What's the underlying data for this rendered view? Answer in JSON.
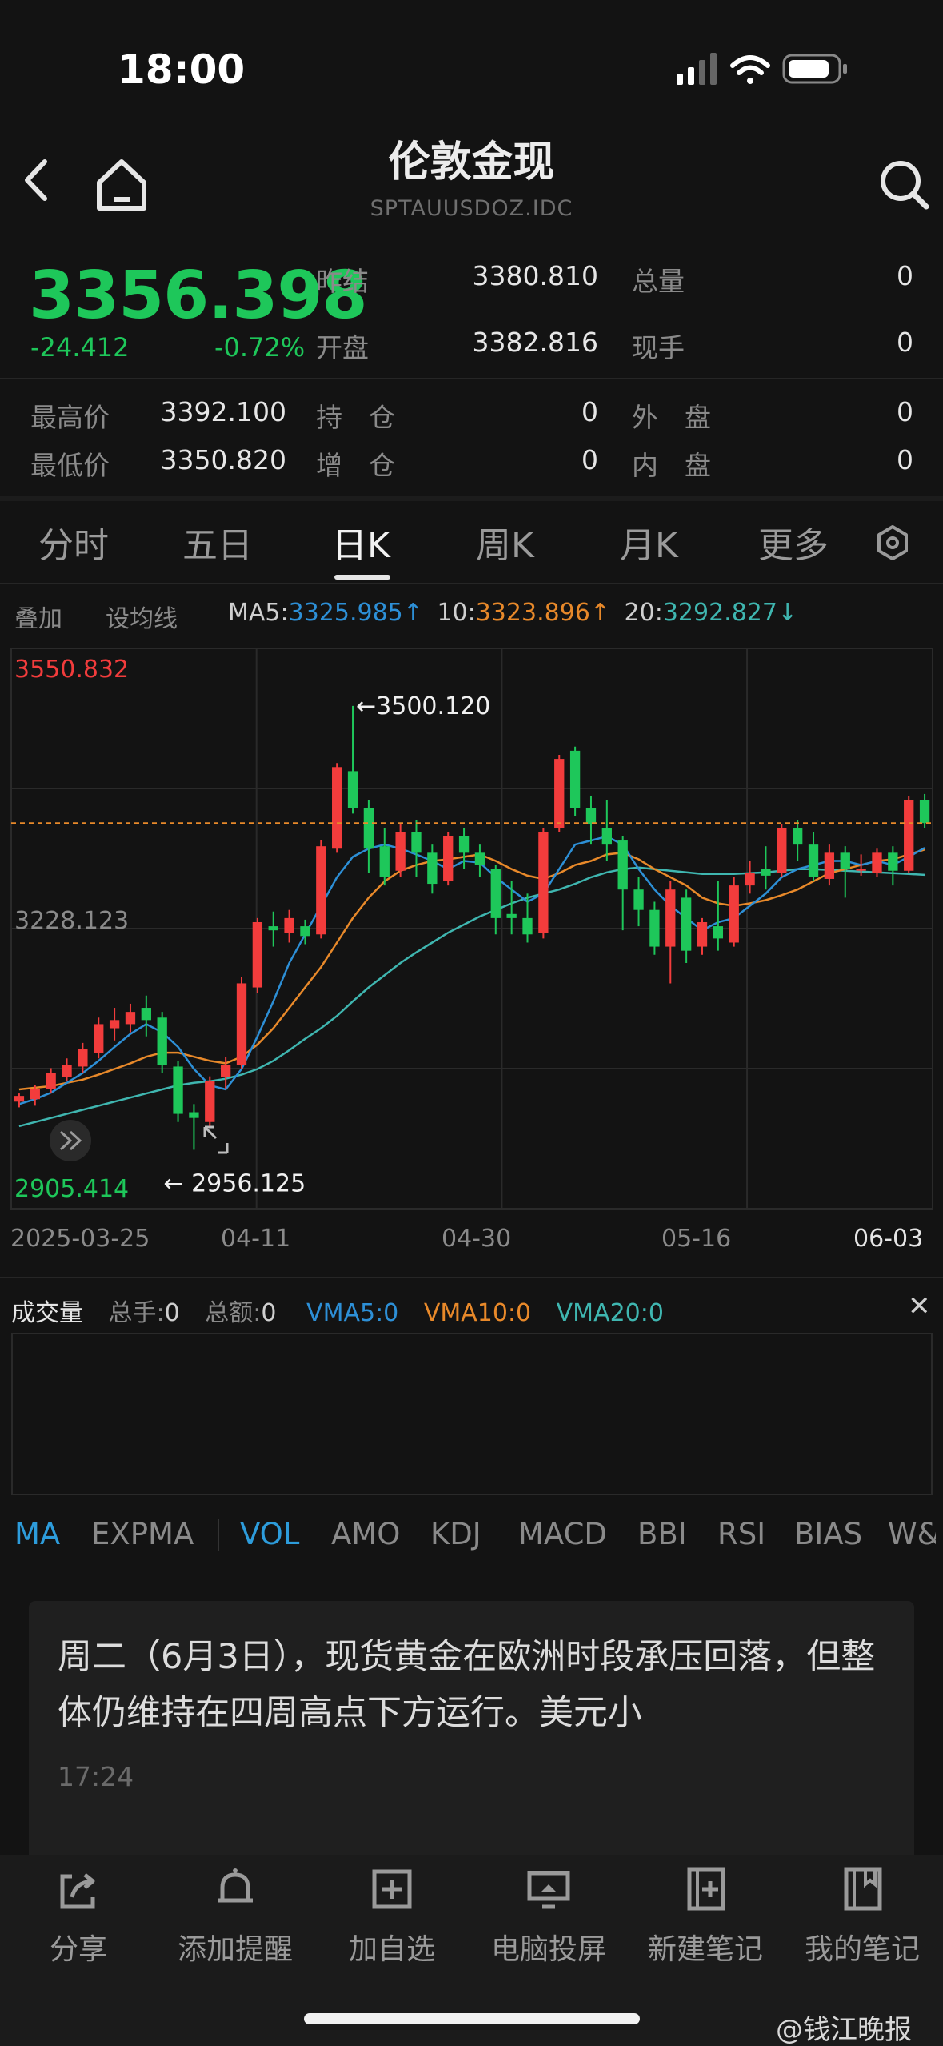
{
  "status": {
    "time": "18:00"
  },
  "header": {
    "title": "伦敦金现",
    "symbol": "SPTAUUSDOZ.IDC"
  },
  "quote": {
    "price": "3356.398",
    "change": "-24.412",
    "change_pct": "-0.72%",
    "prev_settle_label": "昨结",
    "prev_settle": "3380.810",
    "open_label": "开盘",
    "open": "3382.816",
    "total_vol_label": "总量",
    "total_vol": "0",
    "cur_hand_label": "现手",
    "cur_hand": "0",
    "high_label": "最高价",
    "high": "3392.100",
    "low_label": "最低价",
    "low": "3350.820",
    "hold_label": "持　仓",
    "hold": "0",
    "add_label": "增　仓",
    "add": "0",
    "outer_label": "外　盘",
    "outer": "0",
    "inner_label": "内　盘",
    "inner": "0"
  },
  "period_tabs": [
    "分时",
    "五日",
    "日K",
    "周K",
    "月K",
    "更多"
  ],
  "active_period": "日K",
  "ma_row": {
    "overlay": "叠加",
    "set_ma": "设均线",
    "ma5_label": "MA5:",
    "ma5": "3325.985↑",
    "ma10_label": "10:",
    "ma10": "3323.896↑",
    "ma20_label": "20:",
    "ma20": "3292.827↓"
  },
  "colors": {
    "up": "#f23c3c",
    "down": "#1ec75a",
    "ma5": "#2d8fd6",
    "ma10": "#e8892a",
    "ma20": "#3fb6b0",
    "last_price_line": "#e8892a"
  },
  "chart_data": {
    "type": "candlestick",
    "ylim": [
      2905.414,
      3550.832
    ],
    "y_labels": {
      "top": "3550.832",
      "mid": "3228.123",
      "bottom": "2905.414"
    },
    "max_marker": "3500.120",
    "min_marker": "2956.125",
    "last_price": 3356.398,
    "x_labels": [
      "2025-03-25",
      "04-11",
      "04-30",
      "05-16",
      "06-03"
    ],
    "candles": [
      [
        3015,
        3022,
        3008,
        3025
      ],
      [
        3018,
        3030,
        3010,
        3035
      ],
      [
        3030,
        3050,
        3025,
        3056
      ],
      [
        3045,
        3060,
        3040,
        3068
      ],
      [
        3058,
        3080,
        3050,
        3087
      ],
      [
        3075,
        3110,
        3068,
        3118
      ],
      [
        3105,
        3115,
        3090,
        3130
      ],
      [
        3110,
        3125,
        3100,
        3135
      ],
      [
        3130,
        3115,
        3095,
        3145
      ],
      [
        3118,
        3060,
        3050,
        3125
      ],
      [
        3058,
        3000,
        2990,
        3065
      ],
      [
        3002,
        2995,
        2956,
        3012
      ],
      [
        2990,
        3040,
        2985,
        3046
      ],
      [
        3045,
        3060,
        3030,
        3070
      ],
      [
        3060,
        3160,
        3055,
        3168
      ],
      [
        3155,
        3235,
        3148,
        3240
      ],
      [
        3230,
        3225,
        3205,
        3248
      ],
      [
        3222,
        3240,
        3210,
        3250
      ],
      [
        3230,
        3218,
        3208,
        3238
      ],
      [
        3220,
        3328,
        3215,
        3335
      ],
      [
        3325,
        3425,
        3320,
        3430
      ],
      [
        3420,
        3375,
        3368,
        3500
      ],
      [
        3375,
        3325,
        3295,
        3385
      ],
      [
        3328,
        3290,
        3280,
        3350
      ],
      [
        3298,
        3345,
        3290,
        3355
      ],
      [
        3345,
        3320,
        3290,
        3360
      ],
      [
        3320,
        3282,
        3270,
        3330
      ],
      [
        3285,
        3340,
        3280,
        3345
      ],
      [
        3340,
        3320,
        3300,
        3350
      ],
      [
        3320,
        3305,
        3290,
        3330
      ],
      [
        3300,
        3240,
        3220,
        3305
      ],
      [
        3245,
        3240,
        3220,
        3285
      ],
      [
        3240,
        3220,
        3210,
        3270
      ],
      [
        3222,
        3345,
        3215,
        3350
      ],
      [
        3350,
        3435,
        3345,
        3440
      ],
      [
        3445,
        3375,
        3365,
        3450
      ],
      [
        3375,
        3355,
        3330,
        3390
      ],
      [
        3350,
        3330,
        3310,
        3385
      ],
      [
        3335,
        3275,
        3225,
        3340
      ],
      [
        3275,
        3250,
        3230,
        3290
      ],
      [
        3250,
        3205,
        3195,
        3260
      ],
      [
        3205,
        3275,
        3160,
        3285
      ],
      [
        3265,
        3200,
        3185,
        3275
      ],
      [
        3205,
        3235,
        3195,
        3240
      ],
      [
        3230,
        3215,
        3200,
        3285
      ],
      [
        3210,
        3280,
        3205,
        3290
      ],
      [
        3280,
        3295,
        3270,
        3310
      ],
      [
        3300,
        3292,
        3275,
        3328
      ],
      [
        3295,
        3350,
        3290,
        3355
      ],
      [
        3350,
        3330,
        3310,
        3360
      ],
      [
        3330,
        3290,
        3285,
        3345
      ],
      [
        3288,
        3320,
        3280,
        3330
      ],
      [
        3320,
        3300,
        3265,
        3328
      ],
      [
        3300,
        3300,
        3292,
        3318
      ],
      [
        3295,
        3320,
        3290,
        3325
      ],
      [
        3320,
        3298,
        3280,
        3328
      ],
      [
        3298,
        3385,
        3295,
        3390
      ],
      [
        3385,
        3356.4,
        3350,
        3392
      ]
    ],
    "ma5": [
      3012,
      3018,
      3026,
      3038,
      3050,
      3065,
      3082,
      3098,
      3110,
      3100,
      3082,
      3055,
      3035,
      3030,
      3055,
      3095,
      3138,
      3185,
      3220,
      3255,
      3290,
      3315,
      3325,
      3330,
      3325,
      3318,
      3310,
      3300,
      3310,
      3308,
      3290,
      3275,
      3260,
      3270,
      3300,
      3330,
      3335,
      3340,
      3330,
      3300,
      3275,
      3255,
      3240,
      3225,
      3235,
      3240,
      3255,
      3270,
      3290,
      3300,
      3305,
      3310,
      3310,
      3305,
      3310,
      3305,
      3315,
      3326
    ],
    "ma10": [
      3030,
      3032,
      3034,
      3038,
      3042,
      3048,
      3055,
      3062,
      3070,
      3075,
      3075,
      3070,
      3065,
      3062,
      3070,
      3085,
      3105,
      3130,
      3155,
      3180,
      3210,
      3240,
      3265,
      3285,
      3298,
      3305,
      3310,
      3312,
      3315,
      3318,
      3310,
      3300,
      3292,
      3288,
      3295,
      3305,
      3310,
      3318,
      3320,
      3312,
      3300,
      3290,
      3280,
      3265,
      3258,
      3255,
      3258,
      3262,
      3268,
      3275,
      3285,
      3295,
      3300,
      3305,
      3310,
      3312,
      3318,
      3324
    ],
    "ma20": [
      2985,
      2990,
      2995,
      3000,
      3005,
      3010,
      3015,
      3020,
      3025,
      3030,
      3035,
      3038,
      3040,
      3043,
      3048,
      3055,
      3065,
      3078,
      3092,
      3105,
      3120,
      3138,
      3155,
      3170,
      3185,
      3198,
      3210,
      3222,
      3232,
      3242,
      3250,
      3258,
      3265,
      3270,
      3275,
      3282,
      3290,
      3296,
      3300,
      3302,
      3300,
      3298,
      3296,
      3294,
      3294,
      3294,
      3295,
      3296,
      3298,
      3300,
      3300,
      3299,
      3298,
      3297,
      3296,
      3295,
      3294,
      3293
    ]
  },
  "volume": {
    "title": "成交量",
    "total_hands_label": "总手:",
    "total_hands": "0",
    "total_amt_label": "总额:",
    "total_amt": "0",
    "vma5": "VMA5:0",
    "vma10": "VMA10:0",
    "vma20": "VMA20:0",
    "close_icon": "close-icon"
  },
  "indicator_tabs": [
    "MA",
    "EXPMA",
    "VOL",
    "AMO",
    "KDJ",
    "MACD",
    "BBI",
    "RSI",
    "BIAS",
    "W&"
  ],
  "news": {
    "text": "周二（6月3日），现货黄金在欧洲时段承压回落，但整体仍维持在四周高点下方运行。美元小",
    "time": "17:24"
  },
  "bottom_bar": [
    {
      "label": "分享",
      "icon": "share-icon"
    },
    {
      "label": "添加提醒",
      "icon": "bell-icon"
    },
    {
      "label": "加自选",
      "icon": "add-watchlist-icon"
    },
    {
      "label": "电脑投屏",
      "icon": "cast-icon"
    },
    {
      "label": "新建笔记",
      "icon": "new-note-icon"
    },
    {
      "label": "我的笔记",
      "icon": "my-notes-icon"
    }
  ],
  "watermark": "@钱江晚报"
}
